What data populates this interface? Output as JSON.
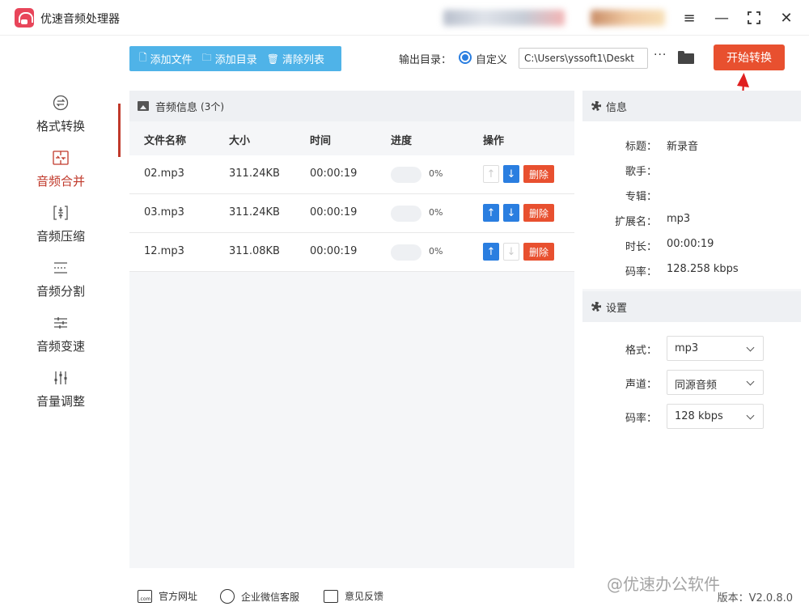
{
  "app": {
    "title": "优速音频处理器"
  },
  "sidebar": {
    "items": [
      {
        "label": "格式转换",
        "icon": "format-convert-icon"
      },
      {
        "label": "音频合并",
        "icon": "merge-icon",
        "active": true
      },
      {
        "label": "音频压缩",
        "icon": "compress-icon"
      },
      {
        "label": "音频分割",
        "icon": "split-icon"
      },
      {
        "label": "音频变速",
        "icon": "speed-icon"
      },
      {
        "label": "音量调整",
        "icon": "volume-adjust-icon"
      }
    ]
  },
  "toolbar": {
    "add_file": "添加文件",
    "add_dir": "添加目录",
    "clear_list": "清除列表",
    "output_label": "输出目录：",
    "radio_label": "自定义",
    "output_path": "C:\\Users\\yssoft1\\Deskt",
    "more": "···",
    "start": "开始转换"
  },
  "files": {
    "header": "音频信息",
    "count": "(3个)",
    "columns": [
      "文件名称",
      "大小",
      "时间",
      "进度",
      "操作"
    ],
    "delete_label": "删除",
    "rows": [
      {
        "name": "02.mp3",
        "size": "311.24KB",
        "time": "00:00:19",
        "progress": "0%",
        "progress_value": 0,
        "up_enabled": false,
        "down_enabled": true
      },
      {
        "name": "03.mp3",
        "size": "311.24KB",
        "time": "00:00:19",
        "progress": "0%",
        "progress_value": 0,
        "up_enabled": true,
        "down_enabled": true
      },
      {
        "name": "12.mp3",
        "size": "311.08KB",
        "time": "00:00:19",
        "progress": "0%",
        "progress_value": 0,
        "up_enabled": true,
        "down_enabled": false
      }
    ]
  },
  "info": {
    "header": "信息",
    "rows": [
      {
        "key": "标题：",
        "value": "新录音"
      },
      {
        "key": "歌手：",
        "value": ""
      },
      {
        "key": "专辑：",
        "value": ""
      },
      {
        "key": "扩展名：",
        "value": "mp3"
      },
      {
        "key": "时长：",
        "value": "00:00:19"
      },
      {
        "key": "码率：",
        "value": "128.258 kbps"
      }
    ]
  },
  "settings": {
    "header": "设置",
    "rows": [
      {
        "key": "格式：",
        "value": "mp3"
      },
      {
        "key": "声道：",
        "value": "同源音频"
      },
      {
        "key": "码率：",
        "value": "128 kbps"
      }
    ]
  },
  "footer": {
    "website": "官方网址",
    "wechat": "企业微信客服",
    "feedback": "意见反馈",
    "version": "版本：V2.0.8.0",
    "watermark": "@优速办公软件"
  },
  "colors": {
    "accent_blue": "#4fb3e8",
    "primary_blue": "#2a7ee0",
    "danger": "#e8502f",
    "active_red": "#c0392b"
  }
}
